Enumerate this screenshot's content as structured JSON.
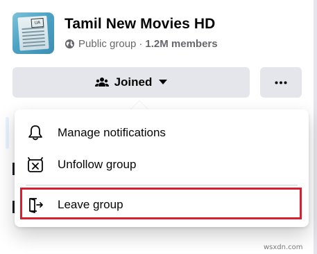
{
  "group": {
    "name": "Tamil New Movies HD",
    "privacy": "Public group",
    "separator": "·",
    "members": "1.2M members",
    "cover_badge": "UA"
  },
  "actions": {
    "joined_label": "Joined",
    "more_icon": "more-horizontal-icon",
    "people_icon": "people-icon",
    "caret_icon": "caret-down-icon"
  },
  "menu": {
    "items": [
      {
        "label": "Manage notifications",
        "icon": "bell-icon"
      },
      {
        "label": "Unfollow group",
        "icon": "unfollow-box-icon"
      },
      {
        "label": "Leave group",
        "icon": "exit-door-icon"
      }
    ],
    "highlighted_index": 2
  },
  "watermark": "wsxdn.com",
  "colors": {
    "button_bg": "#e4e6eb",
    "highlight": "#d6202f",
    "meta_text": "#65676b"
  }
}
